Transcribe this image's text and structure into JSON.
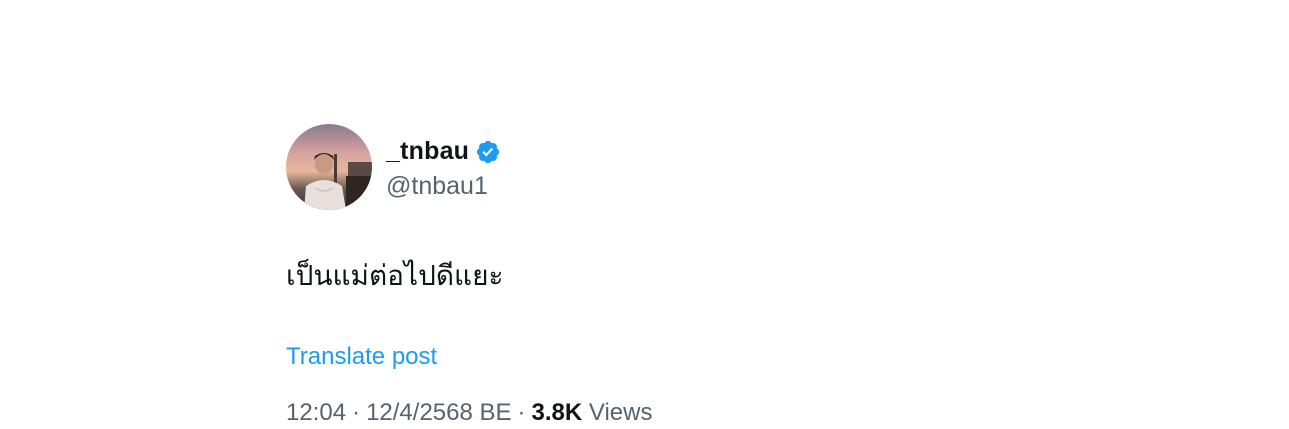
{
  "author": {
    "display_name": "_tnbau",
    "handle": "@tnbau1",
    "verified": true,
    "verified_color": "#1d9bf0"
  },
  "post": {
    "text": "เป็นแม่ต่อไปดีแยะ",
    "translate_label": "Translate post"
  },
  "meta": {
    "time": "12:04",
    "separator": "·",
    "date": "12/4/2568 BE",
    "views_count": "3.8K",
    "views_label": "Views"
  },
  "colors": {
    "link": "#1d9bf0",
    "secondary_text": "#536471",
    "primary_text": "#0f1419"
  }
}
